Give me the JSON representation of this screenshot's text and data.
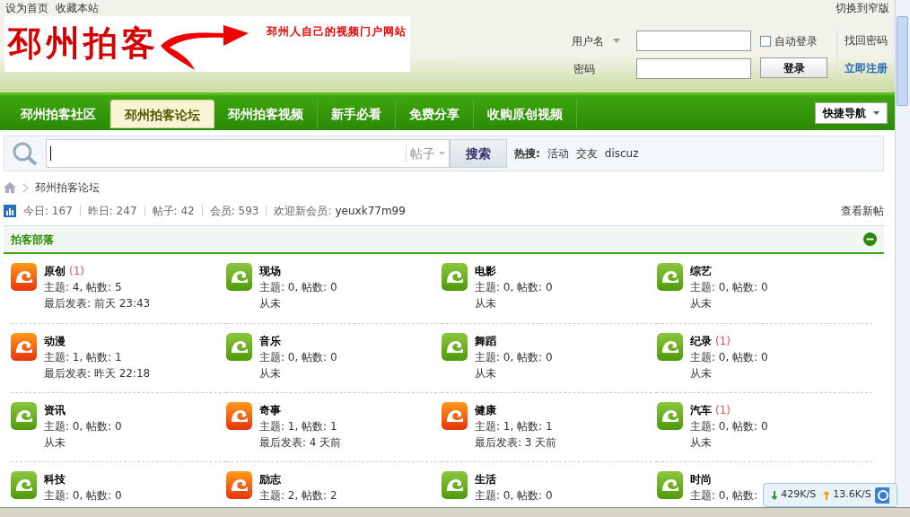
{
  "top_links": [
    "设为首页",
    "收藏本站"
  ],
  "switch_link": "切换到窄版",
  "logo": {
    "title": "邳州拍客",
    "slogan": "邳州人自己的视频门户网站"
  },
  "login": {
    "username_label": "用户名",
    "password_label": "密码",
    "auto_login": {
      "label": "自动登录",
      "checked": false
    },
    "login_button": "登录",
    "forgot": "找回密码",
    "register": "立即注册"
  },
  "nav": [
    {
      "label": "邳州拍客社区",
      "selected": false
    },
    {
      "label": "邳州拍客论坛",
      "selected": true
    },
    {
      "label": "邳州拍客视频",
      "selected": false
    },
    {
      "label": "新手必看",
      "selected": false
    },
    {
      "label": "免费分享",
      "selected": false
    },
    {
      "label": "收购原创视频",
      "selected": false
    }
  ],
  "quick_nav": "快捷导航",
  "search": {
    "scope": "帖子",
    "button": "搜索",
    "hot_label": "热搜:",
    "hot": [
      "活动",
      "交友",
      "discuz"
    ]
  },
  "breadcrumb": "邳州拍客论坛",
  "stats": [
    {
      "label": "今日:",
      "value": "167"
    },
    {
      "label": "昨日:",
      "value": "247"
    },
    {
      "label": "帖子:",
      "value": "42"
    },
    {
      "label": "会员:",
      "value": "593"
    }
  ],
  "welcome": {
    "label": "欢迎新会员:",
    "user": "yeuxk77m99"
  },
  "new_posts_link": "查看新帖",
  "section": {
    "title": "拍客部落",
    "expanded": true,
    "forums": [
      {
        "name": "原创",
        "count": "(1)",
        "new": true,
        "stats": "主题: 4, 帖数: 5",
        "last": "最后发表: 前天 23:43"
      },
      {
        "name": "现场",
        "new": false,
        "stats": "主题: 0, 帖数: 0",
        "last": "从未"
      },
      {
        "name": "电影",
        "new": false,
        "stats": "主题: 0, 帖数: 0",
        "last": "从未"
      },
      {
        "name": "综艺",
        "new": false,
        "stats": "主题: 0, 帖数: 0",
        "last": "从未"
      },
      {
        "name": "动漫",
        "new": true,
        "stats": "主题: 1, 帖数: 1",
        "last": "最后发表: 昨天 22:18"
      },
      {
        "name": "音乐",
        "new": false,
        "stats": "主题: 0, 帖数: 0",
        "last": "从未"
      },
      {
        "name": "舞蹈",
        "new": false,
        "stats": "主题: 0, 帖数: 0",
        "last": "从未"
      },
      {
        "name": "纪录",
        "count": "(1)",
        "new": false,
        "stats": "主题: 0, 帖数: 0",
        "last": "从未"
      },
      {
        "name": "资讯",
        "new": false,
        "stats": "主题: 0, 帖数: 0",
        "last": "从未"
      },
      {
        "name": "奇事",
        "new": true,
        "stats": "主题: 1, 帖数: 1",
        "last": "最后发表: 4 天前"
      },
      {
        "name": "健康",
        "new": true,
        "stats": "主题: 1, 帖数: 1",
        "last": "最后发表: 3 天前"
      },
      {
        "name": "汽车",
        "count": "(1)",
        "new": false,
        "stats": "主题: 0, 帖数: 0",
        "last": "从未"
      },
      {
        "name": "科技",
        "new": false,
        "stats": "主题: 0, 帖数: 0"
      },
      {
        "name": "励志",
        "new": true,
        "stats": "主题: 2, 帖数: 2"
      },
      {
        "name": "生活",
        "new": false,
        "stats": "主题: 0, 帖数: 0"
      },
      {
        "name": "时尚",
        "new": false,
        "stats": "主题: 0, 帖数:"
      }
    ]
  },
  "speed_widget": {
    "down": "429K/S",
    "up": "13.6K/S"
  }
}
